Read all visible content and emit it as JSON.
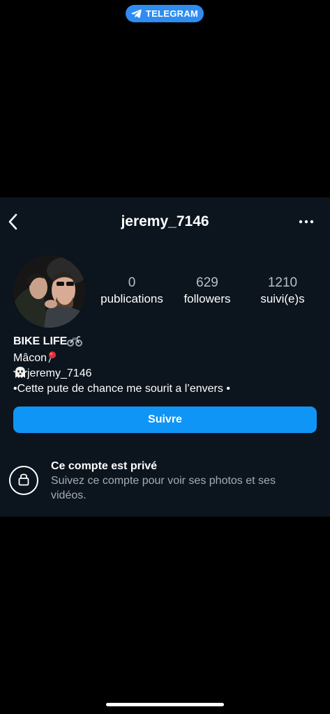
{
  "status_bar": {
    "telegram_label": "TELEGRAM",
    "icon": "telegram-plane-icon"
  },
  "header": {
    "username": "jeremy_7146",
    "back_icon": "chevron-left-icon",
    "more_icon": "more-horizontal-icon"
  },
  "stats": {
    "posts": {
      "value": "0",
      "label": "publications"
    },
    "followers": {
      "value": "629",
      "label": "followers"
    },
    "following": {
      "value": "1210",
      "label": "suivi(e)s"
    }
  },
  "bio": {
    "name": "BIKE LIFE",
    "name_emoji": "motorcycle-icon",
    "city": "Mâcon",
    "city_emoji": "round-pushpin-icon",
    "snap_emoji": "ghost-icon",
    "snap_handle": "jeremy_7146",
    "quote": "•Cette pute de chance me sourit a l’envers •"
  },
  "follow_button": {
    "label": "Suivre"
  },
  "private_notice": {
    "title": "Ce compte est privé",
    "description": "Suivez ce compte pour voir ses photos et ses vidéos.",
    "icon": "lock-icon"
  },
  "colors": {
    "panel_bg": "#0c141d",
    "accent": "#0f95f6",
    "telegram": "#2f8cf0",
    "muted_text": "#a8acb2"
  }
}
